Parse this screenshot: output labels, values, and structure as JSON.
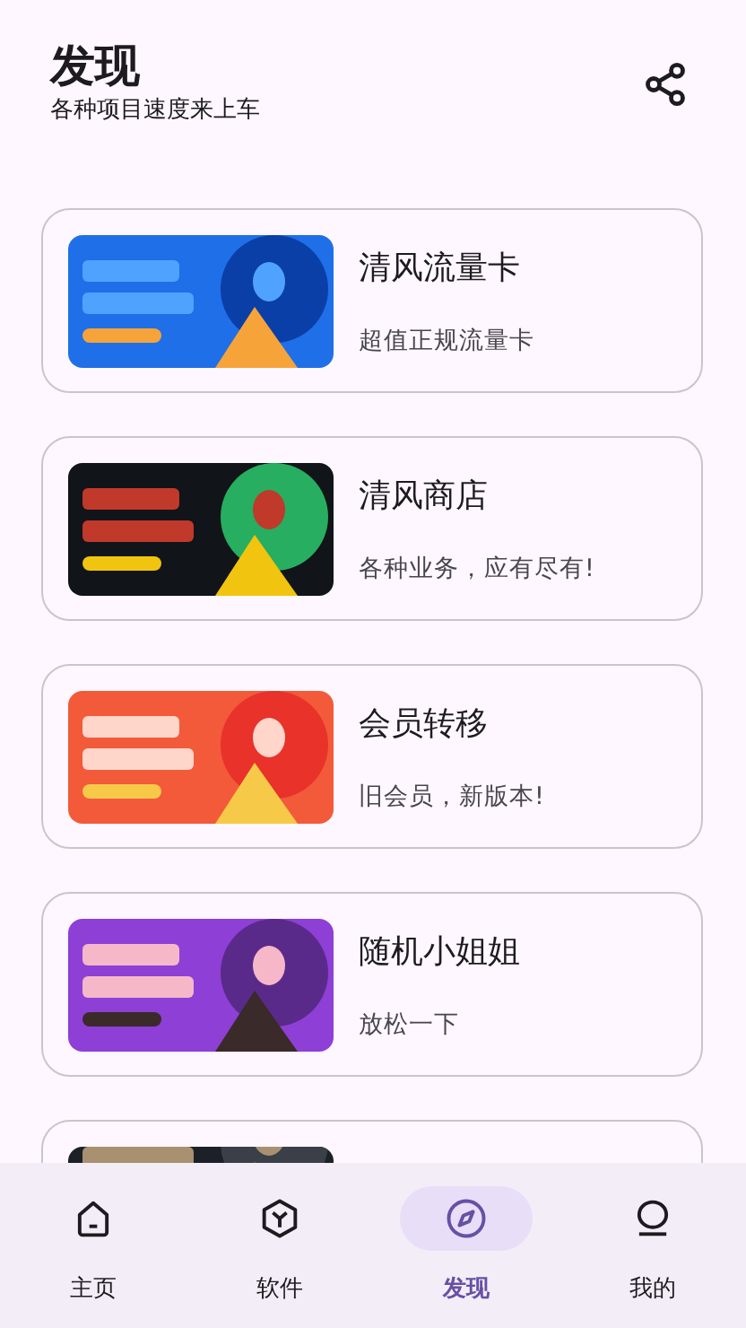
{
  "header": {
    "title": "发现",
    "subtitle": "各种项目速度来上车"
  },
  "cards": [
    {
      "kind": "item",
      "title": "清风流量卡",
      "subtitle": "超值正规流量卡"
    },
    {
      "kind": "item",
      "title": "清风商店",
      "subtitle": "各种业务，应有尽有!"
    },
    {
      "kind": "item",
      "title": "会员转移",
      "subtitle": "旧会员，新版本!"
    },
    {
      "kind": "item",
      "title": "随机小姐姐",
      "subtitle": "放松一下"
    },
    {
      "kind": "picture"
    }
  ],
  "nav": [
    {
      "kind": "home",
      "label": "主页",
      "selected": false
    },
    {
      "kind": "cube",
      "label": "软件",
      "selected": false
    },
    {
      "kind": "compass",
      "label": "发现",
      "selected": true
    },
    {
      "kind": "person",
      "label": "我的",
      "selected": false
    }
  ]
}
